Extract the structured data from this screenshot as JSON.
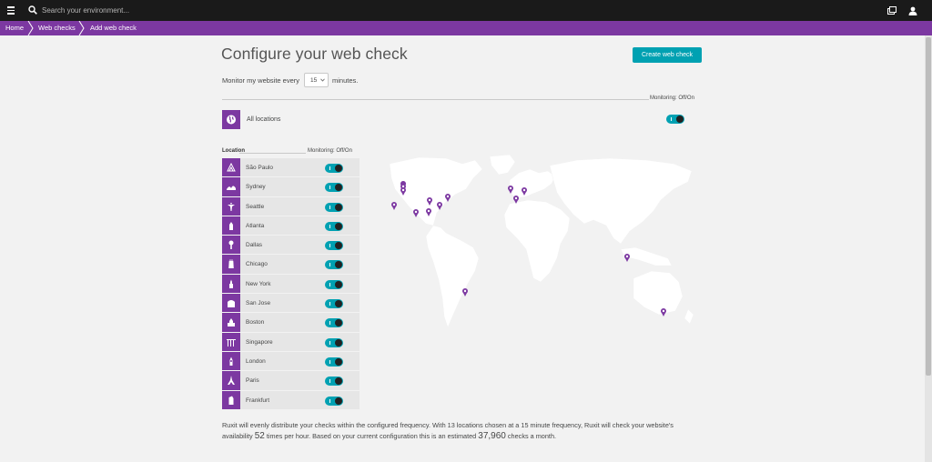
{
  "topbar": {
    "search_placeholder": "Search your environment..."
  },
  "breadcrumb": {
    "items": [
      "Home",
      "Web checks",
      "Add web check"
    ]
  },
  "page": {
    "title": "Configure your web check",
    "create_button": "Create web check"
  },
  "frequency": {
    "prefix": "Monitor my website every",
    "value": "15",
    "suffix": "minutes."
  },
  "all_locations": {
    "monitoring_label": "Monitoring: Off/On",
    "label": "All locations",
    "enabled": true
  },
  "locations": {
    "header": "Location",
    "monitoring_header": "Monitoring: Off/On",
    "items": [
      {
        "name": "São Paulo",
        "icon": "sao-paulo-landmark-icon",
        "enabled": true
      },
      {
        "name": "Sydney",
        "icon": "sydney-opera-house-icon",
        "enabled": true
      },
      {
        "name": "Seattle",
        "icon": "space-needle-icon",
        "enabled": true
      },
      {
        "name": "Atlanta",
        "icon": "atlanta-building-icon",
        "enabled": true
      },
      {
        "name": "Dallas",
        "icon": "dallas-tower-icon",
        "enabled": true
      },
      {
        "name": "Chicago",
        "icon": "chicago-tower-icon",
        "enabled": true
      },
      {
        "name": "New York",
        "icon": "new-york-building-icon",
        "enabled": true
      },
      {
        "name": "San Jose",
        "icon": "san-jose-building-icon",
        "enabled": true
      },
      {
        "name": "Boston",
        "icon": "boston-building-icon",
        "enabled": true
      },
      {
        "name": "Singapore",
        "icon": "singapore-landmark-icon",
        "enabled": true
      },
      {
        "name": "London",
        "icon": "big-ben-icon",
        "enabled": true
      },
      {
        "name": "Paris",
        "icon": "eiffel-tower-icon",
        "enabled": true
      },
      {
        "name": "Frankfurt",
        "icon": "frankfurt-building-icon",
        "enabled": true
      }
    ]
  },
  "footer": {
    "part1": "Ruxit will evenly distribute your checks within the configured frequency. With 13 locations chosen at a 15 minute frequency, Ruxit will check your website's availability",
    "times": "52",
    "part2": "times per hour. Based on your current configuration this is an estimated",
    "checks": "37,960",
    "part3": "checks a month."
  },
  "colors": {
    "accent": "#7c38a1",
    "toggle_on": "#00a1b2",
    "topbar": "#1a1a1a"
  }
}
